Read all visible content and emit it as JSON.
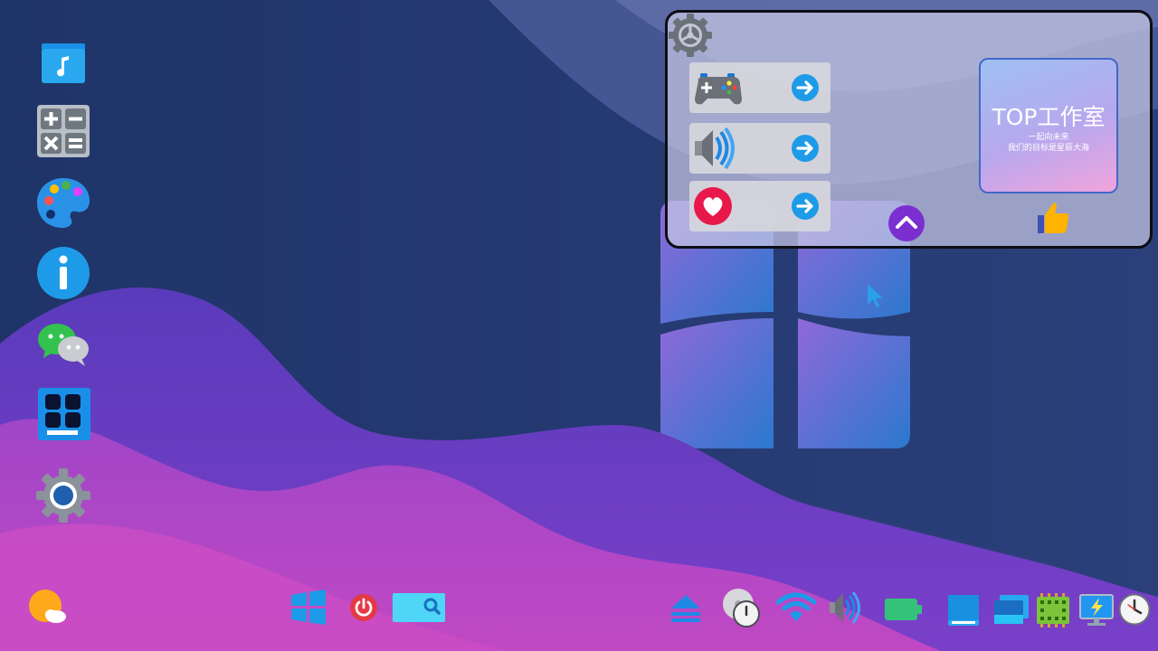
{
  "desktop": {
    "icons": [
      {
        "name": "music-folder-icon"
      },
      {
        "name": "calculator-icon"
      },
      {
        "name": "paint-palette-icon"
      },
      {
        "name": "info-icon"
      },
      {
        "name": "chat-icon"
      },
      {
        "name": "app-store-icon"
      },
      {
        "name": "settings-gear-icon"
      }
    ]
  },
  "panel": {
    "tiles": [
      {
        "name": "gamepad-icon",
        "action": "arrow-right-icon"
      },
      {
        "name": "volume-icon",
        "action": "arrow-right-icon"
      },
      {
        "name": "heart-icon",
        "action": "arrow-right-icon"
      }
    ],
    "studio": {
      "title": "TOP工作室",
      "line1": "一起向未来",
      "line2": "我们的目标是星辰大海"
    }
  },
  "taskbar": {
    "left": [
      "weather-icon"
    ],
    "center": [
      "start-windows-icon",
      "power-icon",
      "search-icon"
    ],
    "tray": [
      "eject-icon",
      "disk-clock-icon",
      "wifi-icon",
      "volume-icon",
      "battery-icon",
      "window-icon",
      "desktop-icon",
      "chip-icon",
      "monitor-icon",
      "clock-icon"
    ]
  },
  "colors": {
    "background": "#1e3266",
    "accent": "#2196f3",
    "purple": "#7b2fd0"
  }
}
